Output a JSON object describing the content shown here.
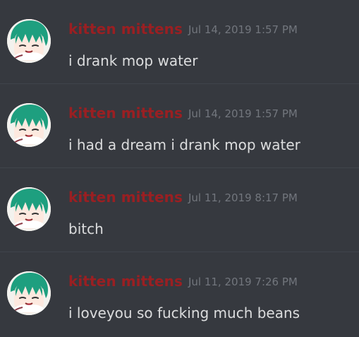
{
  "messages": [
    {
      "username": "kitten mittens",
      "timestamp": "Jul 14, 2019 1:57 PM",
      "text": "i drank mop water"
    },
    {
      "username": "kitten mittens",
      "timestamp": "Jul 14, 2019 1:57 PM",
      "text": "i had a dream i drank mop water"
    },
    {
      "username": "kitten mittens",
      "timestamp": "Jul 11, 2019 8:17 PM",
      "text": "bitch"
    },
    {
      "username": "kitten mittens",
      "timestamp": "Jul 11, 2019 7:26 PM",
      "text": "i loveyou so fucking much beans"
    }
  ],
  "colors": {
    "background": "#36393f",
    "divider": "#40444b",
    "username": "#9a1f22",
    "timestamp": "#72767d",
    "message_text": "#dcddde"
  },
  "icons": {
    "avatar": "anime-character-avatar-icon"
  }
}
